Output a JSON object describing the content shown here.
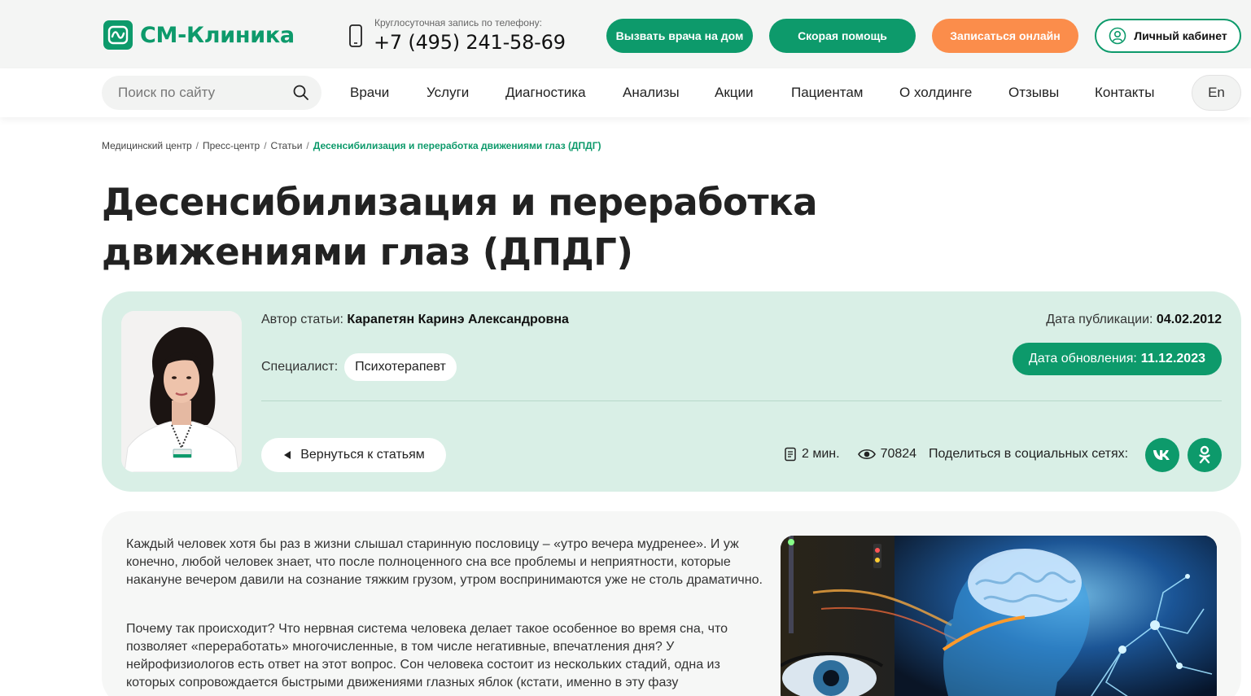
{
  "header": {
    "logo_text": "СМ-Клиника",
    "phone_caption": "Круглосуточная запись по телефону:",
    "phone_number": "+7 (495) 241-58-69",
    "buttons": {
      "doctor_home": "Вызвать врача на дом",
      "ambulance": "Скорая помощь",
      "book_online": "Записаться онлайн",
      "account": "Личный кабинет"
    },
    "colors": {
      "brand": "#0d9a6b",
      "accent": "#fb8d4b"
    }
  },
  "nav": {
    "search_placeholder": "Поиск по сайту",
    "items": [
      "Врачи",
      "Услуги",
      "Диагностика",
      "Анализы",
      "Акции",
      "Пациентам",
      "О холдинге",
      "Отзывы",
      "Контакты"
    ],
    "lang": "En"
  },
  "breadcrumb": [
    "Медицинский центр",
    "Пресс-центр",
    "Статьи",
    "Десенсибилизация и переработка движениями глаз (ДПДГ)"
  ],
  "article_header": {
    "title": "Десенсибилизация и переработка движениями глаз (ДПДГ)",
    "author_label": "Автор статьи:",
    "author_name": "Карапетян Каринэ Александровна",
    "specialist_label": "Специалист:",
    "specialist_value": "Психотерапевт",
    "published_label": "Дата публикации:",
    "published_date": "04.02.2012",
    "updated_label": "Дата обновления:",
    "updated_date": "11.12.2023",
    "back_button": "Вернуться к статьям",
    "read_time": "2 мин.",
    "views": "70824",
    "share_label": "Поделиться в социальных сетях:"
  },
  "article_body": {
    "paragraphs": [
      "Каждый человек хотя бы раз в жизни слышал старинную пословицу – «утро вечера мудренее». И уж конечно, любой человек знает, что после полноценного сна все проблемы и неприятности, которые накануне вечером давили на сознание тяжким грузом, утром воспринимаются уже не столь драматично.",
      "Почему так происходит? Что нервная система человека делает такое особенное во время сна, что позволяет «переработать» многочисленные, в том числе негативные, впечатления дня? У нейрофизиологов есть ответ на этот вопрос. Сон человека состоит из нескольких стадий, одна из которых сопровождается быстрыми движениями глазных яблок (кстати, именно в эту фазу"
    ]
  }
}
